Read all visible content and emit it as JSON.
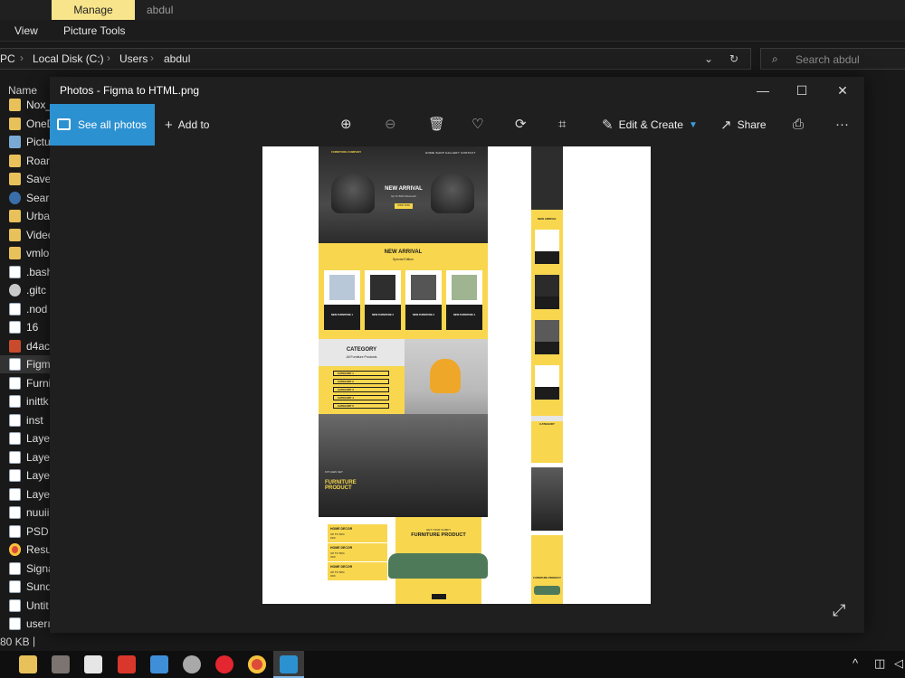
{
  "explorer": {
    "context_tab": "Manage",
    "window_user": "abdul",
    "ribbon_tabs": [
      "View",
      "Picture Tools"
    ],
    "breadcrumb": [
      "PC",
      "Local Disk (C:)",
      "Users",
      "abdul"
    ],
    "search_placeholder": "Search abdul",
    "column_name": "Name",
    "files": [
      {
        "label": "Nox_",
        "type": "folder"
      },
      {
        "label": "OneD",
        "type": "folder"
      },
      {
        "label": "Pictu",
        "type": "img"
      },
      {
        "label": "Roan",
        "type": "folder"
      },
      {
        "label": "Save",
        "type": "folder"
      },
      {
        "label": "Searc",
        "type": "srch"
      },
      {
        "label": "Urba",
        "type": "folder"
      },
      {
        "label": "Video",
        "type": "folder"
      },
      {
        "label": "vmlo",
        "type": "folder"
      },
      {
        "label": ".bash",
        "type": "doc"
      },
      {
        "label": ".gitc",
        "type": "gear"
      },
      {
        "label": ".nod",
        "type": "doc"
      },
      {
        "label": "16",
        "type": "doc"
      },
      {
        "label": "d4ac",
        "type": "zip"
      },
      {
        "label": "Figm",
        "type": "doc",
        "selected": true
      },
      {
        "label": "Furni",
        "type": "doc"
      },
      {
        "label": "inittk",
        "type": "doc"
      },
      {
        "label": "inst",
        "type": "doc"
      },
      {
        "label": "Layer",
        "type": "doc"
      },
      {
        "label": "Layer",
        "type": "doc"
      },
      {
        "label": "Layer",
        "type": "doc"
      },
      {
        "label": "Layer",
        "type": "doc"
      },
      {
        "label": "nuuii",
        "type": "doc"
      },
      {
        "label": "PSD t",
        "type": "doc"
      },
      {
        "label": "Resu",
        "type": "chrome"
      },
      {
        "label": "Signa",
        "type": "doc"
      },
      {
        "label": "Sund",
        "type": "doc"
      },
      {
        "label": "Untit",
        "type": "doc"
      },
      {
        "label": "userı",
        "type": "doc"
      }
    ],
    "status": "80 KB"
  },
  "photos": {
    "title": "Photos - Figma to HTML.png",
    "see_all": "See all photos",
    "add_to": "Add to",
    "edit_create": "Edit & Create",
    "share": "Share",
    "more": "···"
  },
  "design": {
    "hero_logo": "FURNITURE\nCOMPANY",
    "hero_nav": "HOME  SHOP  GALLERY  CONTACT",
    "hero_title": "NEW ARRIVAL",
    "hero_sub": "Up To 50% Discount!",
    "hero_btn": "SHOP NOW",
    "section_title": "NEW ARRIVAL",
    "section_sub": "Special Edition",
    "cards": [
      "NEW FURNITURE 1",
      "NEW FURNITURE 2",
      "NEW FURNITURE 3",
      "NEW FURNITURE 4"
    ],
    "category_title": "CATEGORY",
    "category_sub": "All Furniture Products",
    "categories": [
      "CATEGORY 1",
      "CATEGORY 2",
      "CATEGORY 3",
      "CATEGORY 4",
      "CATEGORY 5"
    ],
    "kitchen_small": "KITCHEN SET",
    "kitchen_title": "FURNITURE PRODUCT",
    "decor_items": [
      {
        "title": "HOME DECOR",
        "promo": "UP TO 50% OFF"
      },
      {
        "title": "HOME DECOR",
        "promo": "UP TO 50% OFF"
      },
      {
        "title": "HOME DECOR",
        "promo": "UP TO 50% OFF"
      }
    ],
    "decor_big_sub": "GET YOUR COMFY",
    "decor_big_title": "FURNITURE PRODUCT",
    "mobile_new": "NEW ARRIVAL",
    "mobile_cat": "CATEGORY",
    "mobile_furn": "FURNITURE PRODUCT"
  },
  "colors": {
    "accent_yellow": "#f8d74f",
    "photos_blue": "#2c91d1",
    "manage_tab": "#f7e48b"
  }
}
